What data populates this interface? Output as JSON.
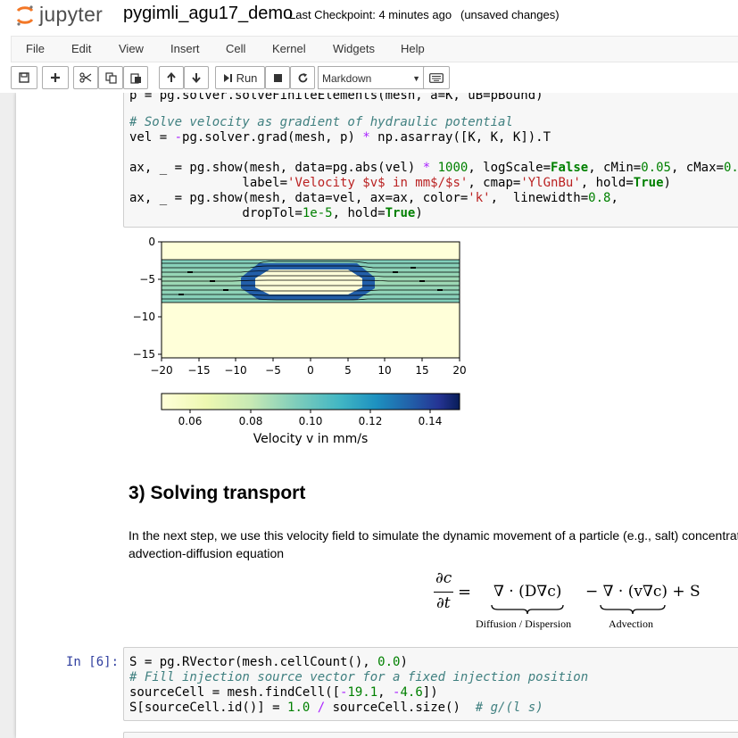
{
  "header": {
    "logo_text": "jupyter",
    "notebook_name": "pygimli_agu17_demo",
    "checkpoint": "Last Checkpoint: 4 minutes ago",
    "autosave": "(unsaved changes)"
  },
  "menubar": {
    "items": [
      "File",
      "Edit",
      "View",
      "Insert",
      "Cell",
      "Kernel",
      "Widgets",
      "Help"
    ]
  },
  "toolbar": {
    "run_label": "Run",
    "cell_type": "Markdown"
  },
  "cell5": {
    "partial_line": "p = pg.solver.solveFiniteElements(mesh, a=K, uB=pBound)",
    "line1": "# Solve velocity as gradient of hydraulic potential",
    "line2a": "vel = ",
    "line2b": "-",
    "line2c": "pg.solver.grad(mesh, p) ",
    "line2d": "*",
    "line2e": " np.asarray([K, K, K]).T",
    "line3a": "ax, _ = pg.show(mesh, data=pg.abs(vel) ",
    "line3b": "*",
    "line3c": " ",
    "line3d": "1000",
    "line3e": ", logScale=",
    "line3f": "False",
    "line3g": ", cMin=",
    "line3h": "0.05",
    "line3i": ", cMax=",
    "line3j": "0.",
    "line4a": "               label=",
    "line4b": "'Velocity $v$ in mm$/$s'",
    "line4c": ", cmap=",
    "line4d": "'YlGnBu'",
    "line4e": ", hold=",
    "line4f": "True",
    "line4g": ")",
    "line5a": "ax, _ = pg.show(mesh, data=vel, ax=ax, color=",
    "line5b": "'k'",
    "line5c": ",  linewidth=",
    "line5d": "0.8",
    "line5e": ",",
    "line6a": "               dropTol=",
    "line6b": "1e-5",
    "line6c": ", hold=",
    "line6d": "True",
    "line6e": ")"
  },
  "plot": {
    "y_ticks": [
      "0",
      "−5",
      "−10",
      "−15"
    ],
    "x_ticks": [
      "−20",
      "−15",
      "−10",
      "−5",
      "0",
      "5",
      "10",
      "15",
      "20"
    ],
    "cbar_ticks": [
      "0.06",
      "0.08",
      "0.10",
      "0.12",
      "0.14"
    ],
    "cbar_label": "Velocity v in mm/s",
    "colors": {
      "low": "#ffffd9",
      "mid": "#41b6c4",
      "high": "#081d58"
    }
  },
  "section": {
    "heading": "3) Solving transport",
    "para_line1": "In the next step, we use this velocity field to simulate the dynamic movement of a particle (e.g., salt) concentrat",
    "para_line2": "advection-diffusion equation"
  },
  "equation": {
    "lhs_num": "∂c",
    "lhs_den": "∂t",
    "equals": "=",
    "diffusion_term": "∇ · (D∇c)",
    "advection_term": "− ∇ · (v∇c) + S",
    "diffusion_label": "Diffusion / Dispersion",
    "advection_label": "Advection"
  },
  "cell6": {
    "prompt": "In [6]:",
    "line1a": "S = pg.RVector(mesh.cellCount(), ",
    "line1b": "0.0",
    "line1c": ")",
    "line2": "# Fill injection source vector for a fixed injection position",
    "line3a": "sourceCell = mesh.findCell([",
    "line3b": "-",
    "line3c": "19.1",
    "line3d": ", ",
    "line3e": "-",
    "line3f": "4.6",
    "line3g": "])",
    "line4a": "S[sourceCell.id()] = ",
    "line4b": "1.0",
    "line4c": " ",
    "line4d": "/",
    "line4e": " sourceCell.size()  ",
    "line4f": "# g/(l s)"
  }
}
